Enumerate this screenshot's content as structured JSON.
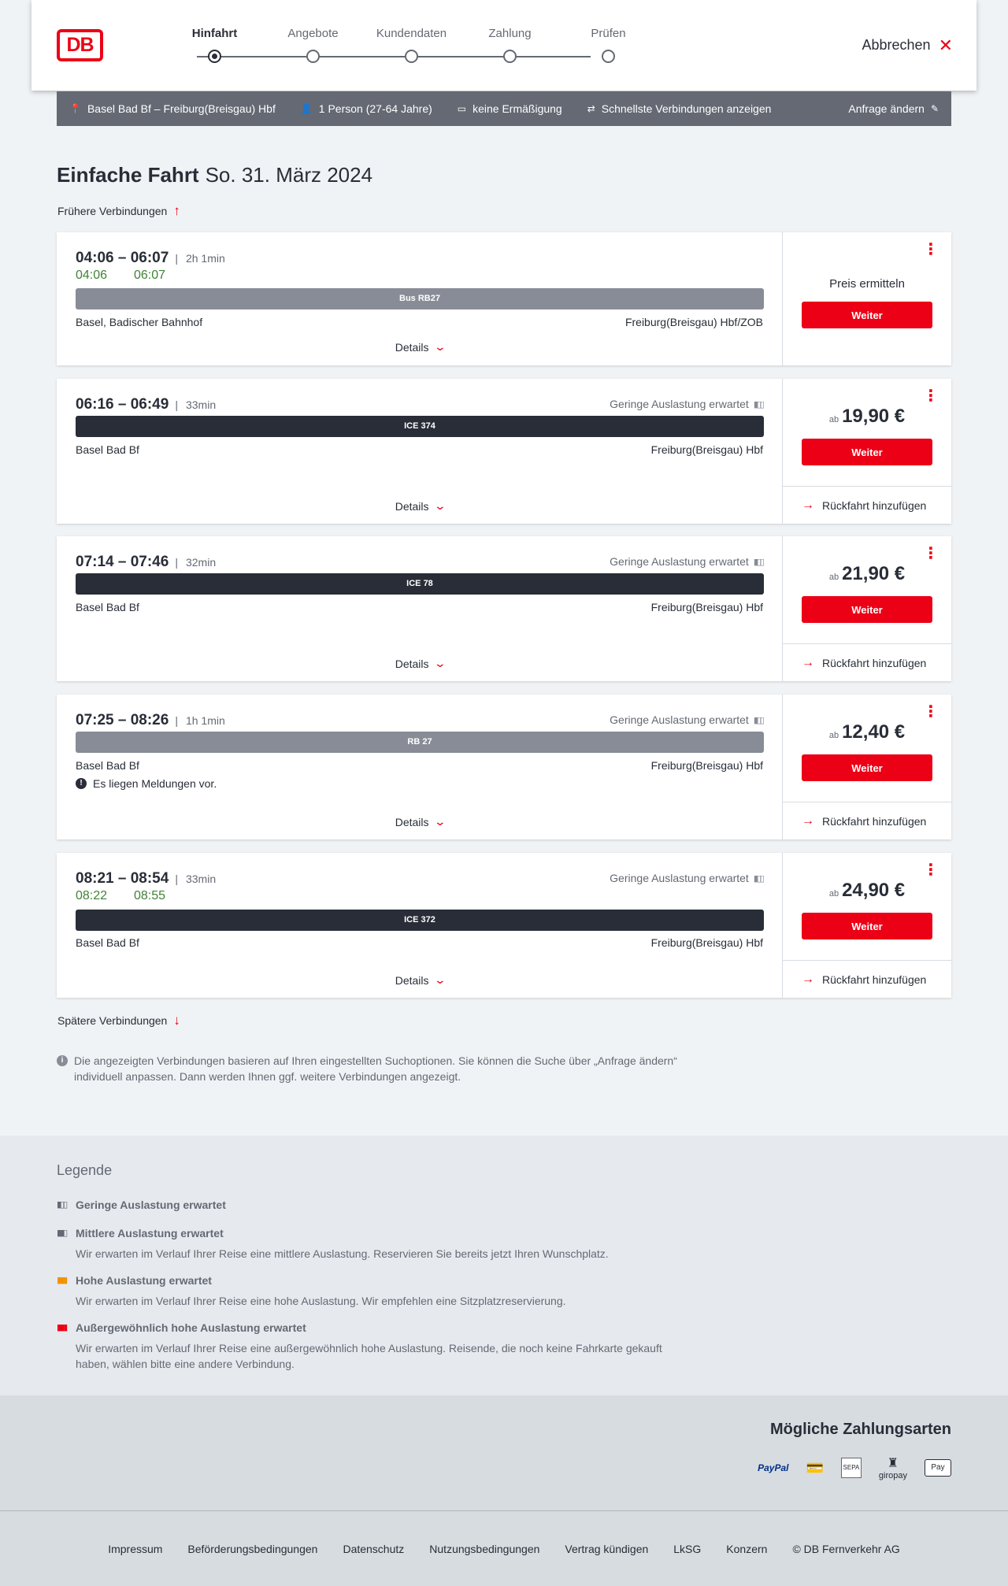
{
  "brand": {
    "logo": "DB",
    "accent": "#ec0016"
  },
  "steps": [
    {
      "label": "Hinfahrt",
      "active": true
    },
    {
      "label": "Angebote",
      "active": false
    },
    {
      "label": "Kundendaten",
      "active": false
    },
    {
      "label": "Zahlung",
      "active": false
    },
    {
      "label": "Prüfen",
      "active": false
    }
  ],
  "cancel_label": "Abbrechen",
  "query": {
    "route": "Basel Bad Bf – Freiburg(Breisgau) Hbf",
    "passengers": "1 Person (27-64 Jahre)",
    "discount": "keine Ermäßigung",
    "option": "Schnellste Verbindungen anzeigen",
    "change": "Anfrage ändern"
  },
  "title": {
    "main": "Einfache Fahrt",
    "date": "So. 31. März 2024"
  },
  "earlier": "Frühere Verbindungen",
  "later": "Spätere Verbindungen",
  "connections": [
    {
      "times": "04:06 – 06:07",
      "duration": "2h 1min",
      "actual_dep": "04:06",
      "actual_arr": "06:07",
      "occupancy": "",
      "train": "Bus RB27",
      "train_style": "grey",
      "from": "Basel, Badischer Bahnhof",
      "to": "Freiburg(Breisgau) Hbf/ZOB",
      "message": "",
      "details": "Details",
      "price_ab": "",
      "price": "",
      "price_calc": "Preis ermitteln",
      "button": "Weiter",
      "return": ""
    },
    {
      "times": "06:16 – 06:49",
      "duration": "33min",
      "actual_dep": "",
      "actual_arr": "",
      "occupancy": "Geringe Auslastung erwartet",
      "train": "ICE 374",
      "train_style": "dark",
      "from": "Basel Bad Bf",
      "to": "Freiburg(Breisgau) Hbf",
      "message": "",
      "details": "Details",
      "price_ab": "ab",
      "price": "19,90 €",
      "price_calc": "",
      "button": "Weiter",
      "return": "Rückfahrt hinzufügen"
    },
    {
      "times": "07:14 – 07:46",
      "duration": "32min",
      "actual_dep": "",
      "actual_arr": "",
      "occupancy": "Geringe Auslastung erwartet",
      "train": "ICE 78",
      "train_style": "dark",
      "from": "Basel Bad Bf",
      "to": "Freiburg(Breisgau) Hbf",
      "message": "",
      "details": "Details",
      "price_ab": "ab",
      "price": "21,90 €",
      "price_calc": "",
      "button": "Weiter",
      "return": "Rückfahrt hinzufügen"
    },
    {
      "times": "07:25 – 08:26",
      "duration": "1h 1min",
      "actual_dep": "",
      "actual_arr": "",
      "occupancy": "Geringe Auslastung erwartet",
      "train": "RB 27",
      "train_style": "grey",
      "from": "Basel Bad Bf",
      "to": "Freiburg(Breisgau) Hbf",
      "message": "Es liegen Meldungen vor.",
      "details": "Details",
      "price_ab": "ab",
      "price": "12,40 €",
      "price_calc": "",
      "button": "Weiter",
      "return": "Rückfahrt hinzufügen"
    },
    {
      "times": "08:21 – 08:54",
      "duration": "33min",
      "actual_dep": "08:22",
      "actual_arr": "08:55",
      "occupancy": "Geringe Auslastung erwartet",
      "train": "ICE 372",
      "train_style": "dark",
      "from": "Basel Bad Bf",
      "to": "Freiburg(Breisgau) Hbf",
      "message": "",
      "details": "Details",
      "price_ab": "ab",
      "price": "24,90 €",
      "price_calc": "",
      "button": "Weiter",
      "return": "Rückfahrt hinzufügen"
    }
  ],
  "info_text": "Die angezeigten Verbindungen basieren auf Ihren eingestellten Suchoptionen. Sie können die Suche über „Anfrage ändern“ individuell anpassen. Dann werden Ihnen ggf. weitere Verbindungen angezeigt.",
  "legend": {
    "title": "Legende",
    "items": [
      {
        "title": "Geringe Auslastung erwartet",
        "desc": "",
        "color": "#646973"
      },
      {
        "title": "Mittlere Auslastung erwartet",
        "desc": "Wir erwarten im Verlauf Ihrer Reise eine mittlere Auslastung. Reservieren Sie bereits jetzt Ihren Wunschplatz.",
        "color": "#646973"
      },
      {
        "title": "Hohe Auslastung erwartet",
        "desc": "Wir erwarten im Verlauf Ihrer Reise eine hohe Auslastung. Wir empfehlen eine Sitzplatzreservierung.",
        "color": "#f39200"
      },
      {
        "title": "Außergewöhnlich hohe Auslastung erwartet",
        "desc": "Wir erwarten im Verlauf Ihrer Reise eine außergewöhnlich hohe Auslastung. Reisende, die noch keine Fahrkarte gekauft haben, wählen bitte eine andere Verbindung.",
        "color": "#ec0016"
      }
    ]
  },
  "payment": {
    "title": "Mögliche Zahlungsarten",
    "methods": [
      "PayPal",
      "Kreditkarte",
      "SEPA Lastschrift",
      "giropay",
      "Pay"
    ]
  },
  "footer": [
    "Impressum",
    "Beförderungsbedingungen",
    "Datenschutz",
    "Nutzungsbedingungen",
    "Vertrag kündigen",
    "LkSG",
    "Konzern",
    "© DB Fernverkehr AG"
  ]
}
